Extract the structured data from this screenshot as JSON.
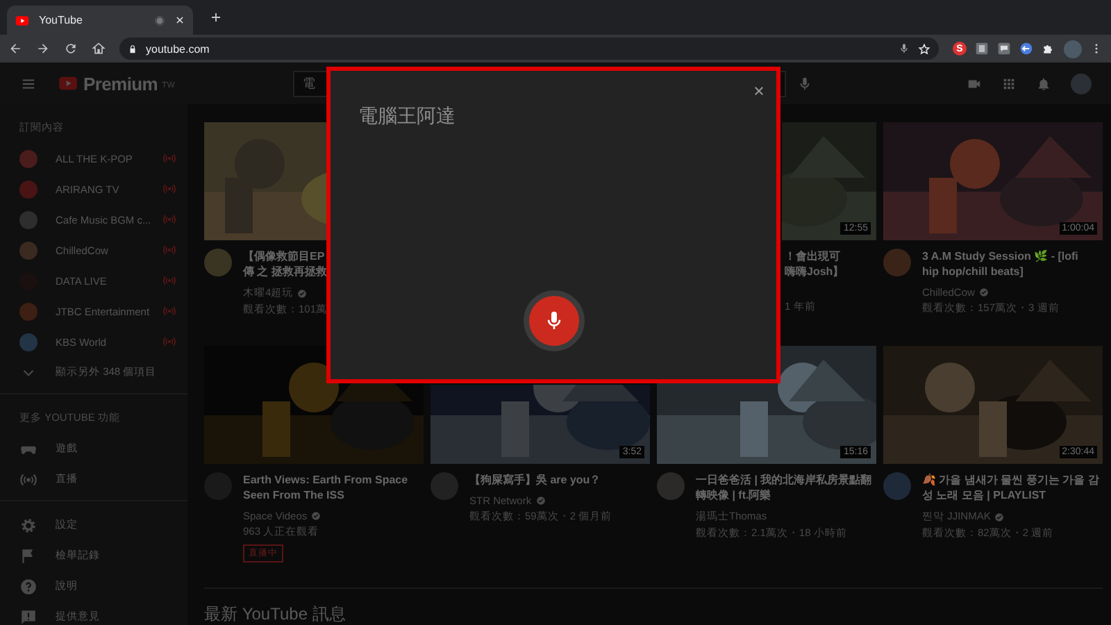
{
  "browser": {
    "tab": {
      "title": "YouTube"
    },
    "address": "youtube.com",
    "extension_badge": "S"
  },
  "header": {
    "logo": "Premium",
    "region": "TW",
    "search": {
      "value": "電"
    }
  },
  "sidebar": {
    "sections": [
      {
        "heading": "訂閱內容",
        "items": [
          {
            "kind": "channel",
            "label": "ALL THE K-POP",
            "live": true
          },
          {
            "kind": "channel",
            "label": "ARIRANG TV",
            "live": true
          },
          {
            "kind": "channel",
            "label": "Cafe Music BGM c...",
            "live": true
          },
          {
            "kind": "channel",
            "label": "ChilledCow",
            "live": true
          },
          {
            "kind": "channel",
            "label": "DATA LIVE",
            "live": true
          },
          {
            "kind": "channel",
            "label": "JTBC Entertainment",
            "live": true
          },
          {
            "kind": "channel",
            "label": "KBS World",
            "live": true
          },
          {
            "kind": "expand",
            "label": "顯示另外 348 個項目"
          }
        ]
      },
      {
        "heading": "更多 YOUTUBE 功能",
        "items": [
          {
            "kind": "feature",
            "label": "遊戲"
          },
          {
            "kind": "feature",
            "label": "直播"
          }
        ]
      },
      {
        "items": [
          {
            "kind": "feature",
            "label": "設定"
          },
          {
            "kind": "feature",
            "label": "檢舉記錄"
          },
          {
            "kind": "feature",
            "label": "說明"
          },
          {
            "kind": "feature",
            "label": "提供意見"
          }
        ]
      }
    ]
  },
  "videos": [
    {
      "kind": "clipped_right",
      "title": "【偶像救節目EP\n傳 之 拯救再拯救",
      "channel": "木曜4超玩",
      "verified": true,
      "meta": [
        "觀看次數：101萬"
      ]
    },
    {
      "kind": "clipped_left",
      "title": "！會出現可嗨嗨Josh】",
      "meta": [
        "1 年前"
      ],
      "duration": "12:55"
    },
    {
      "kind": "full",
      "title": "3 A.M Study Session 🌿 - [lofi\nhip hop/chill beats]",
      "channel": "ChilledCow",
      "verified": true,
      "meta": [
        "觀看次數：157萬次・3 週前"
      ],
      "duration": "1:00:04"
    },
    {
      "kind": "full",
      "title": "Earth Views: Earth From Space\nSeen From The ISS",
      "channel": "Space Videos",
      "verified": true,
      "meta": [
        "963 人正在觀看"
      ],
      "badge": "直播中"
    },
    {
      "kind": "clipped_top",
      "title": "【狗屎寫手】吳 are you？",
      "channel": "STR Network",
      "verified": true,
      "meta": [
        "觀看次數：59萬次・2 個月前"
      ],
      "duration": "3:52"
    },
    {
      "kind": "full",
      "title": "一日爸爸活 | 我的北海岸私房景點翻轉映像 | ft.阿樂",
      "channel": "湯瑪士Thomas",
      "verified": false,
      "meta": [
        "觀看次數：2.1萬次・18 小時前"
      ],
      "duration": "15:16"
    },
    {
      "kind": "full",
      "title": "🍂 가을 냄새가 물씬 풍기는 가을 감\n성 노래 모음 | PLAYLIST",
      "channel": "찐막 JJINMAK",
      "verified": true,
      "meta": [
        "觀看次數：82萬次・2 週前"
      ],
      "duration": "2:30:44"
    }
  ],
  "section_heading": "最新 YouTube 訊息",
  "voice_dialog": {
    "transcript": "電腦王阿達",
    "highlighted": true,
    "listening": true
  }
}
